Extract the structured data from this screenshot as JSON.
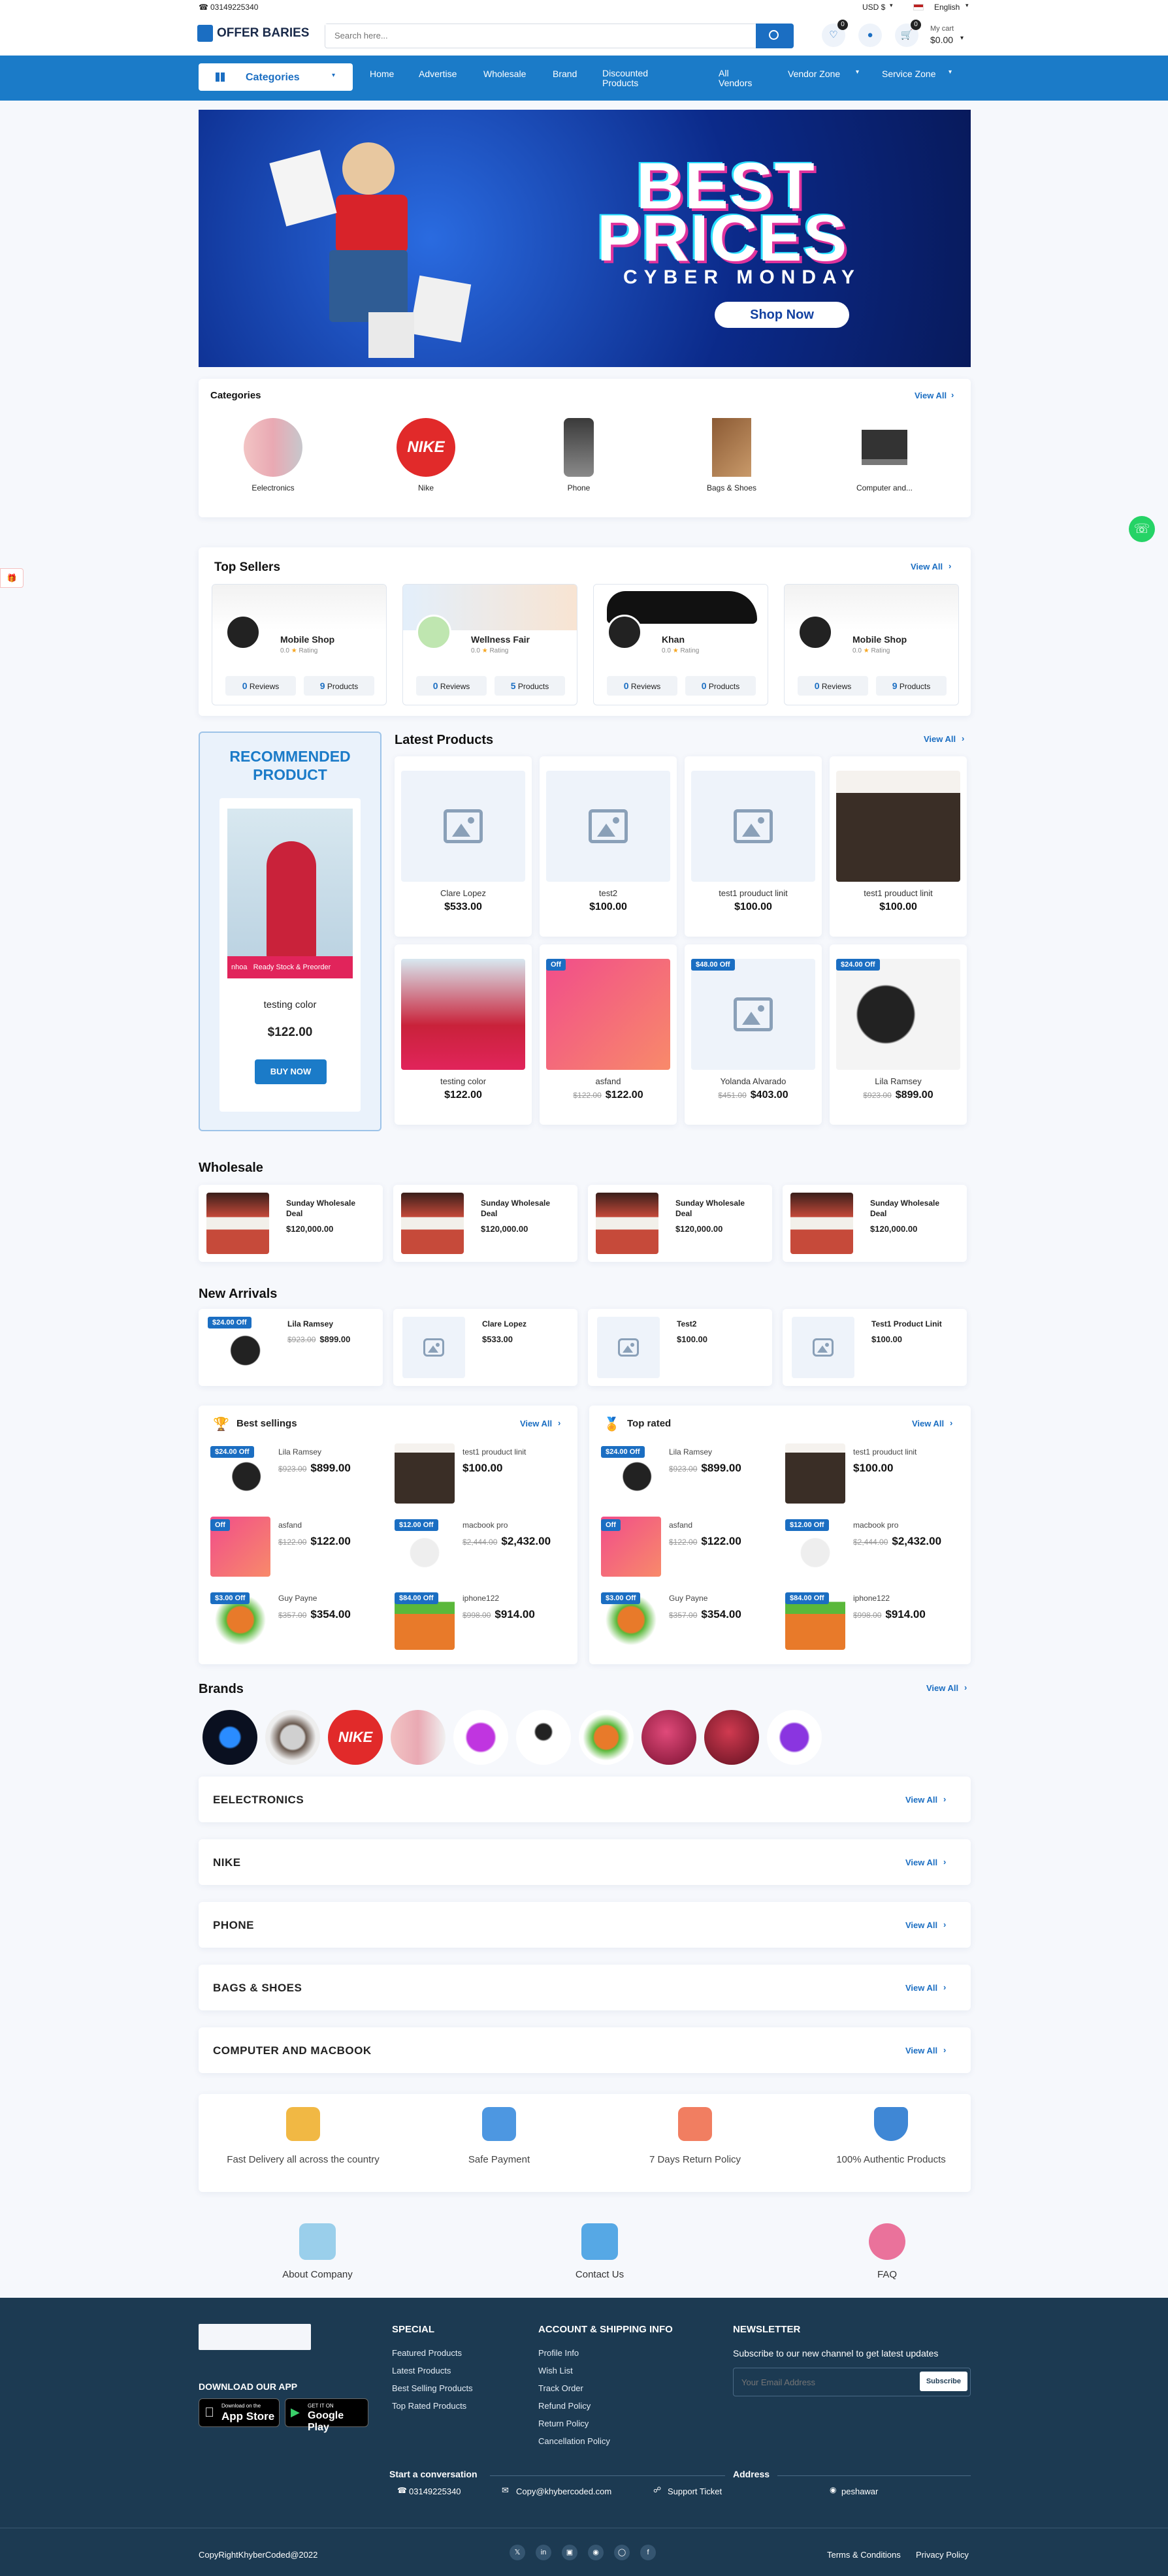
{
  "topbar": {
    "phone": "03149225340",
    "currency": "USD $",
    "language": "English"
  },
  "header": {
    "logo": "OFFER BARIES",
    "search_placeholder": "Search here...",
    "wishlist_count": "0",
    "cart_count": "0",
    "cart_label": "My cart",
    "cart_total": "$0.00"
  },
  "nav": {
    "categories": "Categories",
    "items": [
      "Home",
      "Advertise",
      "Wholesale",
      "Brand",
      "Discounted Products",
      "All Vendors",
      "Vendor Zone",
      "Service Zone"
    ]
  },
  "banner": {
    "line1": "BEST",
    "line2": "PRICES",
    "line3": "CYBER MONDAY",
    "button": "Shop Now"
  },
  "categories": {
    "title": "Categories",
    "view_all": "View All",
    "items": [
      "Eelectronics",
      "Nike",
      "Phone",
      "Bags & Shoes",
      "Computer and..."
    ]
  },
  "top_sellers": {
    "title": "Top Sellers",
    "view_all": "View All",
    "rating_text": "Rating",
    "reviews_label": "Reviews",
    "products_label": "Products",
    "items": [
      {
        "name": "Mobile Shop",
        "rating": "0.0",
        "reviews": "0",
        "products": "9"
      },
      {
        "name": "Wellness Fair",
        "rating": "0.0",
        "reviews": "0",
        "products": "5"
      },
      {
        "name": "Khan",
        "rating": "0.0",
        "reviews": "0",
        "products": "0"
      },
      {
        "name": "Mobile Shop",
        "rating": "0.0",
        "reviews": "0",
        "products": "9"
      }
    ]
  },
  "recommended": {
    "title": "RECOMMENDED PRODUCT",
    "name": "testing color",
    "price": "$122.00",
    "button": "BUY NOW"
  },
  "latest": {
    "title": "Latest Products",
    "view_all": "View All",
    "items": [
      {
        "name": "Clare Lopez",
        "price": "$533.00",
        "old": "",
        "badge": ""
      },
      {
        "name": "test2",
        "price": "$100.00",
        "old": "",
        "badge": ""
      },
      {
        "name": "test1 prouduct linit",
        "price": "$100.00",
        "old": "",
        "badge": ""
      },
      {
        "name": "test1 prouduct linit",
        "price": "$100.00",
        "old": "",
        "badge": ""
      },
      {
        "name": "testing color",
        "price": "$122.00",
        "old": "",
        "badge": ""
      },
      {
        "name": "asfand",
        "price": "$122.00",
        "old": "$122.00",
        "badge": "Off"
      },
      {
        "name": "Yolanda Alvarado",
        "price": "$403.00",
        "old": "$451.00",
        "badge": "$48.00 Off"
      },
      {
        "name": "Lila Ramsey",
        "price": "$899.00",
        "old": "$923.00",
        "badge": "$24.00 Off"
      }
    ]
  },
  "wholesale": {
    "title": "Wholesale",
    "items": [
      {
        "name": "Sunday Wholesale Deal",
        "price": "$120,000.00"
      },
      {
        "name": "Sunday Wholesale Deal",
        "price": "$120,000.00"
      },
      {
        "name": "Sunday Wholesale Deal",
        "price": "$120,000.00"
      },
      {
        "name": "Sunday Wholesale Deal",
        "price": "$120,000.00"
      }
    ]
  },
  "new_arrivals": {
    "title": "New Arrivals",
    "items": [
      {
        "name": "Lila Ramsey",
        "price": "$899.00",
        "old": "$923.00",
        "badge": "$24.00 Off"
      },
      {
        "name": "Clare Lopez",
        "price": "$533.00",
        "old": "",
        "badge": ""
      },
      {
        "name": "Test2",
        "price": "$100.00",
        "old": "",
        "badge": ""
      },
      {
        "name": "Test1 Product Linit",
        "price": "$100.00",
        "old": "",
        "badge": ""
      }
    ]
  },
  "best_selling": {
    "title": "Best sellings",
    "view_all": "View All",
    "items": [
      {
        "name": "Lila Ramsey",
        "price": "$899.00",
        "old": "$923.00",
        "badge": "$24.00 Off"
      },
      {
        "name": "test1 prouduct linit",
        "price": "$100.00",
        "old": "",
        "badge": ""
      },
      {
        "name": "asfand",
        "price": "$122.00",
        "old": "$122.00",
        "badge": "Off"
      },
      {
        "name": "macbook pro",
        "price": "$2,432.00",
        "old": "$2,444.00",
        "badge": "$12.00 Off"
      },
      {
        "name": "Guy Payne",
        "price": "$354.00",
        "old": "$357.00",
        "badge": "$3.00 Off"
      },
      {
        "name": "iphone122",
        "price": "$914.00",
        "old": "$998.00",
        "badge": "$84.00 Off"
      }
    ]
  },
  "top_rated": {
    "title": "Top rated",
    "view_all": "View All",
    "items": [
      {
        "name": "Lila Ramsey",
        "price": "$899.00",
        "old": "$923.00",
        "badge": "$24.00 Off"
      },
      {
        "name": "test1 prouduct linit",
        "price": "$100.00",
        "old": "",
        "badge": ""
      },
      {
        "name": "asfand",
        "price": "$122.00",
        "old": "$122.00",
        "badge": "Off"
      },
      {
        "name": "macbook pro",
        "price": "$2,432.00",
        "old": "$2,444.00",
        "badge": "$12.00 Off"
      },
      {
        "name": "Guy Payne",
        "price": "$354.00",
        "old": "$357.00",
        "badge": "$3.00 Off"
      },
      {
        "name": "iphone122",
        "price": "$914.00",
        "old": "$998.00",
        "badge": "$84.00 Off"
      }
    ]
  },
  "brands": {
    "title": "Brands",
    "view_all": "View All"
  },
  "category_sections": [
    "EELECTRONICS",
    "NIKE",
    "PHONE",
    "BAGS & SHOES",
    "COMPUTER AND MACBOOK"
  ],
  "category_view_all": "View All",
  "features": [
    "Fast Delivery all across the country",
    "Safe Payment",
    "7 Days Return Policy",
    "100% Authentic Products"
  ],
  "links": [
    "About Company",
    "Contact Us",
    "FAQ"
  ],
  "footer": {
    "download": "DOWNLOAD OUR APP",
    "app_store_small": "Download on the",
    "app_store": "App Store",
    "google_small": "GET IT ON",
    "google": "Google Play",
    "special_title": "SPECIAL",
    "special": [
      "Featured Products",
      "Latest Products",
      "Best Selling Products",
      "Top Rated Products"
    ],
    "account_title": "ACCOUNT & SHIPPING INFO",
    "account": [
      "Profile Info",
      "Wish List",
      "Track Order",
      "Refund Policy",
      "Return Policy",
      "Cancellation Policy"
    ],
    "newsletter_title": "NEWSLETTER",
    "newsletter_text": "Subscribe to our new channel to get latest updates",
    "email_placeholder": "Your Email Address",
    "subscribe": "Subscribe",
    "conversation": "Start a conversation",
    "address_title": "Address",
    "phone": "03149225340",
    "email": "Copy@khybercoded.com",
    "support": "Support Ticket",
    "address": "peshawar",
    "copyright": "CopyRightKhyberCoded@2022",
    "terms": "Terms & Conditions",
    "privacy": "Privacy Policy"
  },
  "colors": {
    "primary": "#1b6ec2",
    "footer": "#1c3a52"
  }
}
